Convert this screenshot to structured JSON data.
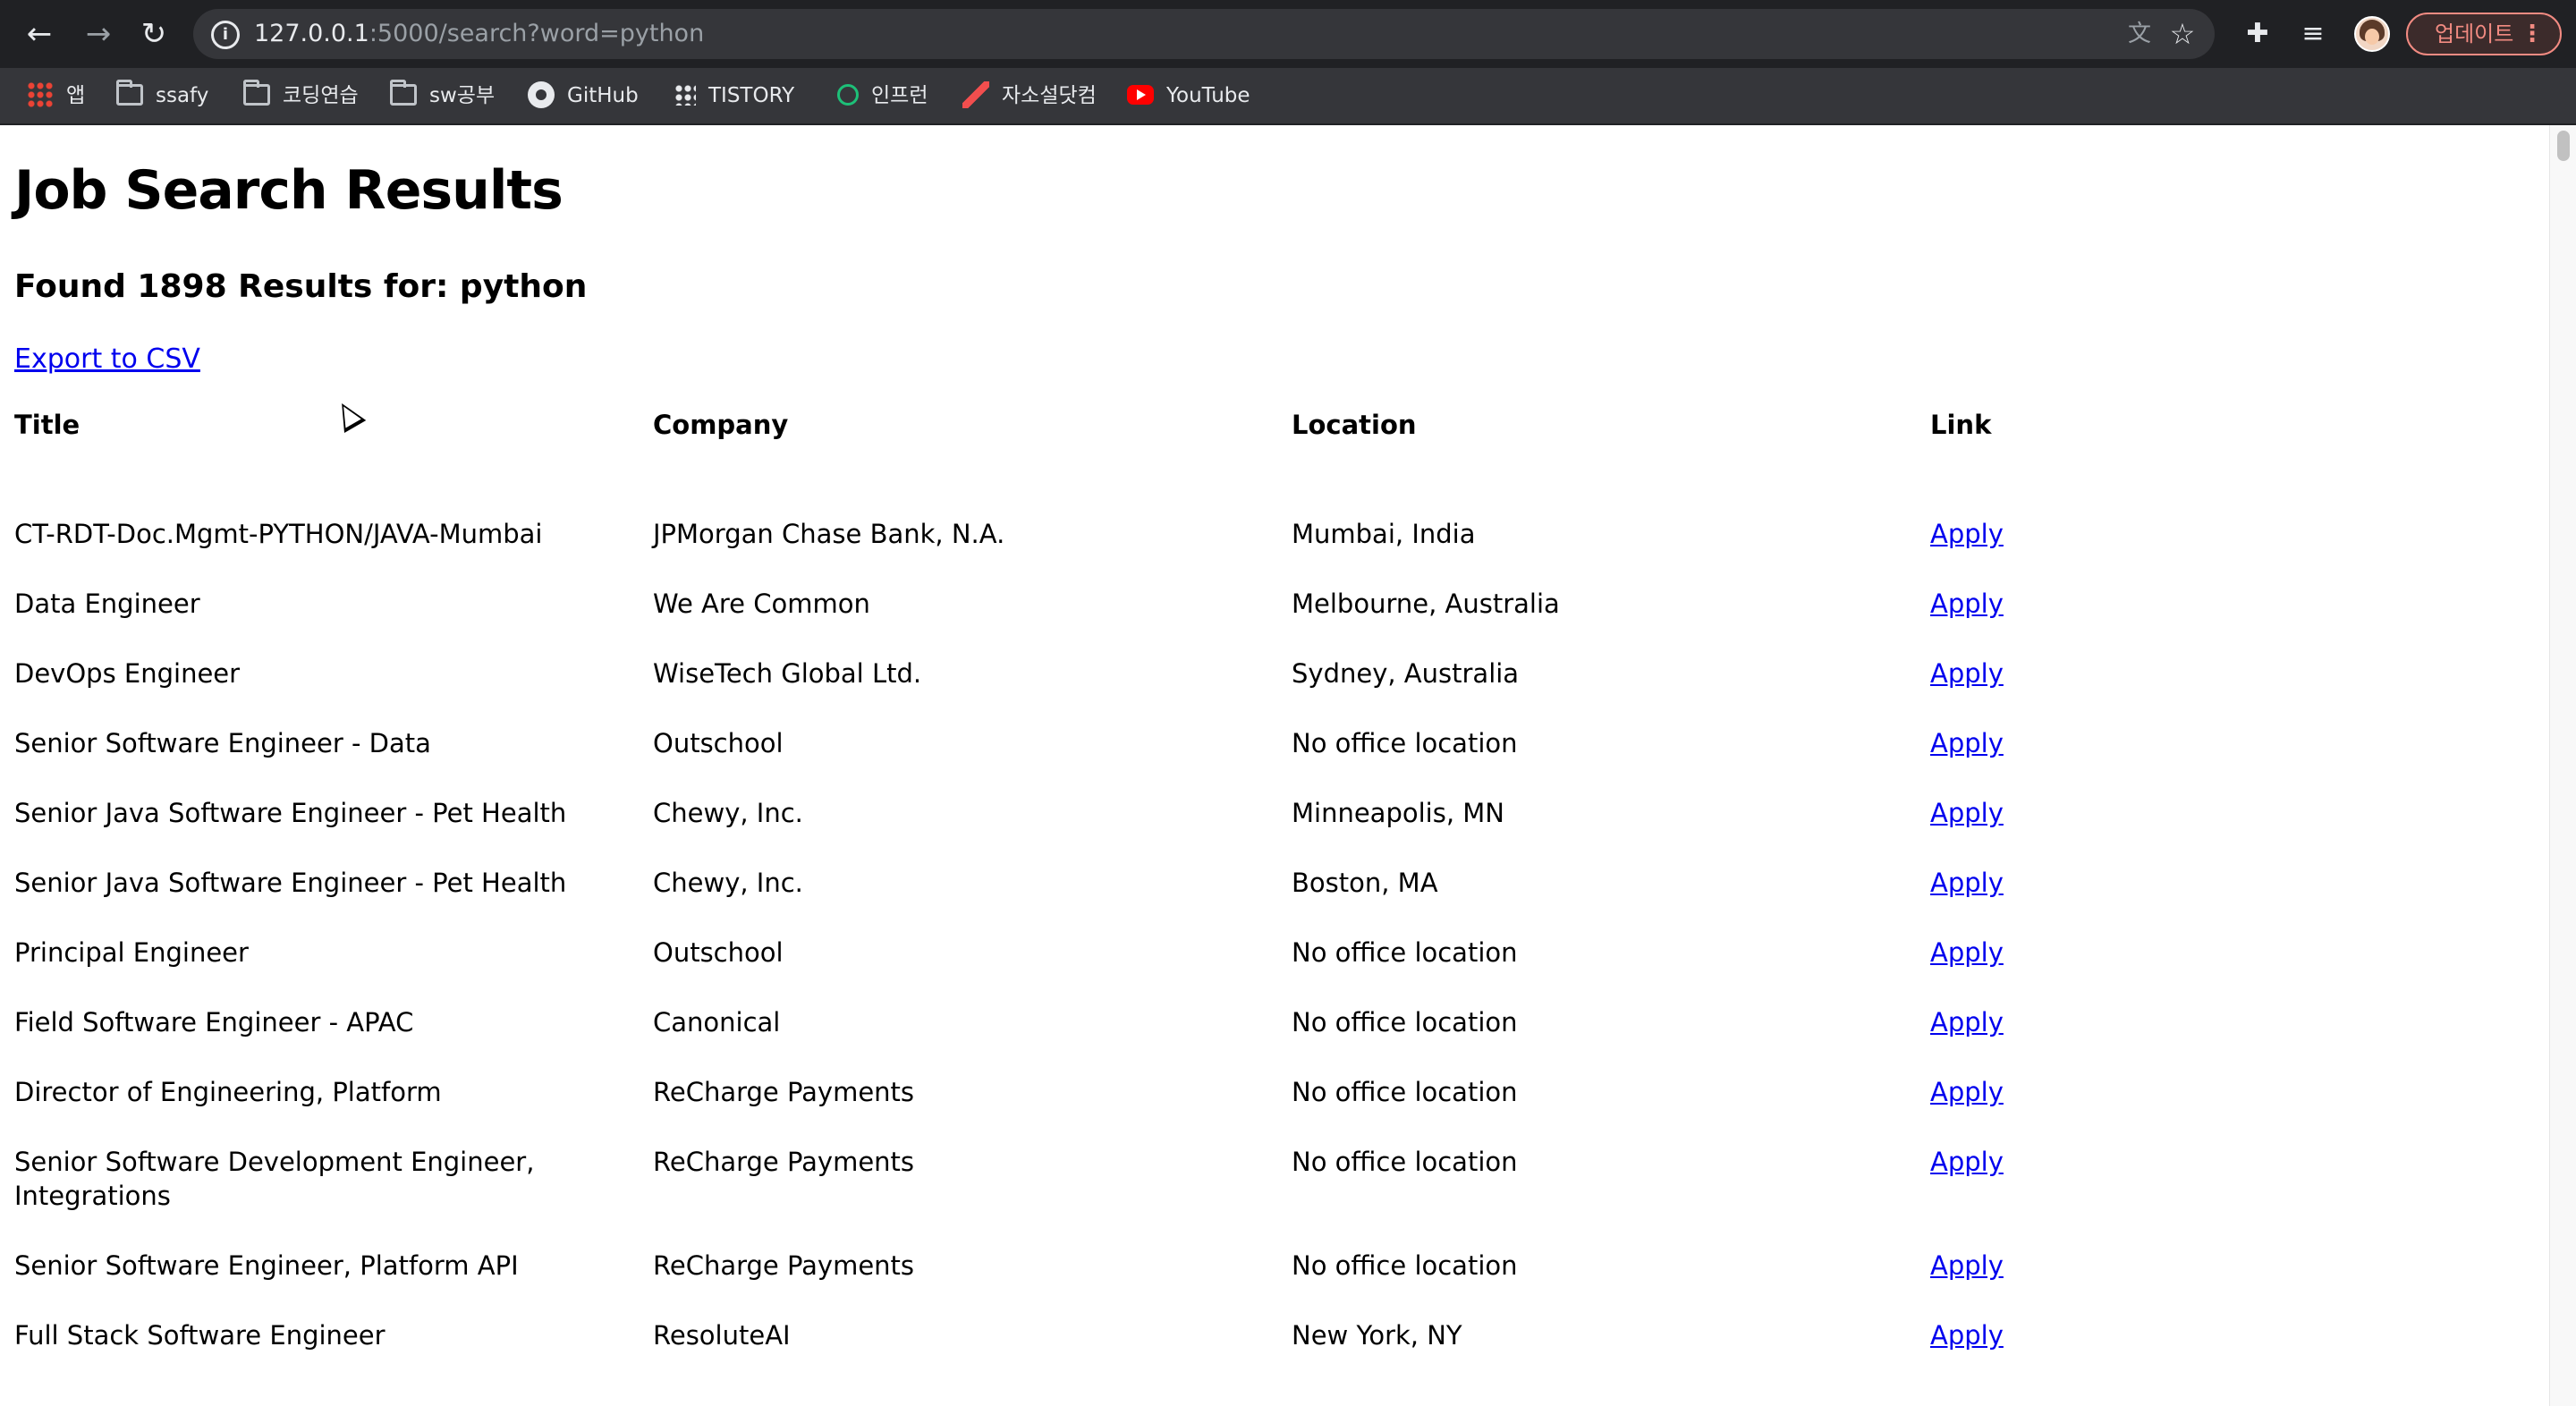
{
  "browser": {
    "url_host": "127.0.0.1",
    "url_path": ":5000/search?word=python",
    "update_label": "업데이트",
    "icons": {
      "back": "arrow-left",
      "forward": "arrow-right",
      "reload": "reload",
      "info": "info",
      "translate": "translate",
      "bookmark_star": "star",
      "extensions": "puzzle",
      "media": "media-queue",
      "menu": "kebab"
    }
  },
  "bookmarks": [
    {
      "label": "앱",
      "icon": "apps-grid"
    },
    {
      "label": "ssafy",
      "icon": "folder"
    },
    {
      "label": "코딩연습",
      "icon": "folder"
    },
    {
      "label": "sw공부",
      "icon": "folder"
    },
    {
      "label": "GitHub",
      "icon": "github"
    },
    {
      "label": "TISTORY",
      "icon": "tistory"
    },
    {
      "label": "인프런",
      "icon": "inflearn"
    },
    {
      "label": "자소설닷컴",
      "icon": "jasoseol"
    },
    {
      "label": "YouTube",
      "icon": "youtube"
    }
  ],
  "page": {
    "title": "Job Search Results",
    "result_count": "Found 1898 Results for: python",
    "export_label": "Export to CSV",
    "table": {
      "headers": [
        "Title",
        "Company",
        "Location",
        "Link"
      ],
      "rows": [
        {
          "title": "CT-RDT-Doc.Mgmt-PYTHON/JAVA-Mumbai",
          "company": "JPMorgan Chase Bank, N.A.",
          "location": "Mumbai, India",
          "link": "Apply"
        },
        {
          "title": "Data Engineer",
          "company": "We Are Common",
          "location": "Melbourne, Australia",
          "link": "Apply"
        },
        {
          "title": "DevOps Engineer",
          "company": "WiseTech Global Ltd.",
          "location": "Sydney, Australia",
          "link": "Apply"
        },
        {
          "title": "Senior Software Engineer - Data",
          "company": "Outschool",
          "location": "No office location",
          "link": "Apply"
        },
        {
          "title": "Senior Java Software Engineer - Pet Health",
          "company": "Chewy, Inc.",
          "location": "Minneapolis, MN",
          "link": "Apply"
        },
        {
          "title": "Senior Java Software Engineer - Pet Health",
          "company": "Chewy, Inc.",
          "location": "Boston, MA",
          "link": "Apply"
        },
        {
          "title": "Principal Engineer",
          "company": "Outschool",
          "location": "No office location",
          "link": "Apply"
        },
        {
          "title": "Field Software Engineer - APAC",
          "company": "Canonical",
          "location": "No office location",
          "link": "Apply"
        },
        {
          "title": "Director of Engineering, Platform",
          "company": "ReCharge Payments",
          "location": "No office location",
          "link": "Apply"
        },
        {
          "title": "Senior Software Development Engineer, Integrations",
          "company": "ReCharge Payments",
          "location": "No office location",
          "link": "Apply"
        },
        {
          "title": "Senior Software Engineer, Platform API",
          "company": "ReCharge Payments",
          "location": "No office location",
          "link": "Apply"
        },
        {
          "title": "Full Stack Software Engineer",
          "company": "ResoluteAI",
          "location": "New York, NY",
          "link": "Apply"
        }
      ]
    }
  }
}
